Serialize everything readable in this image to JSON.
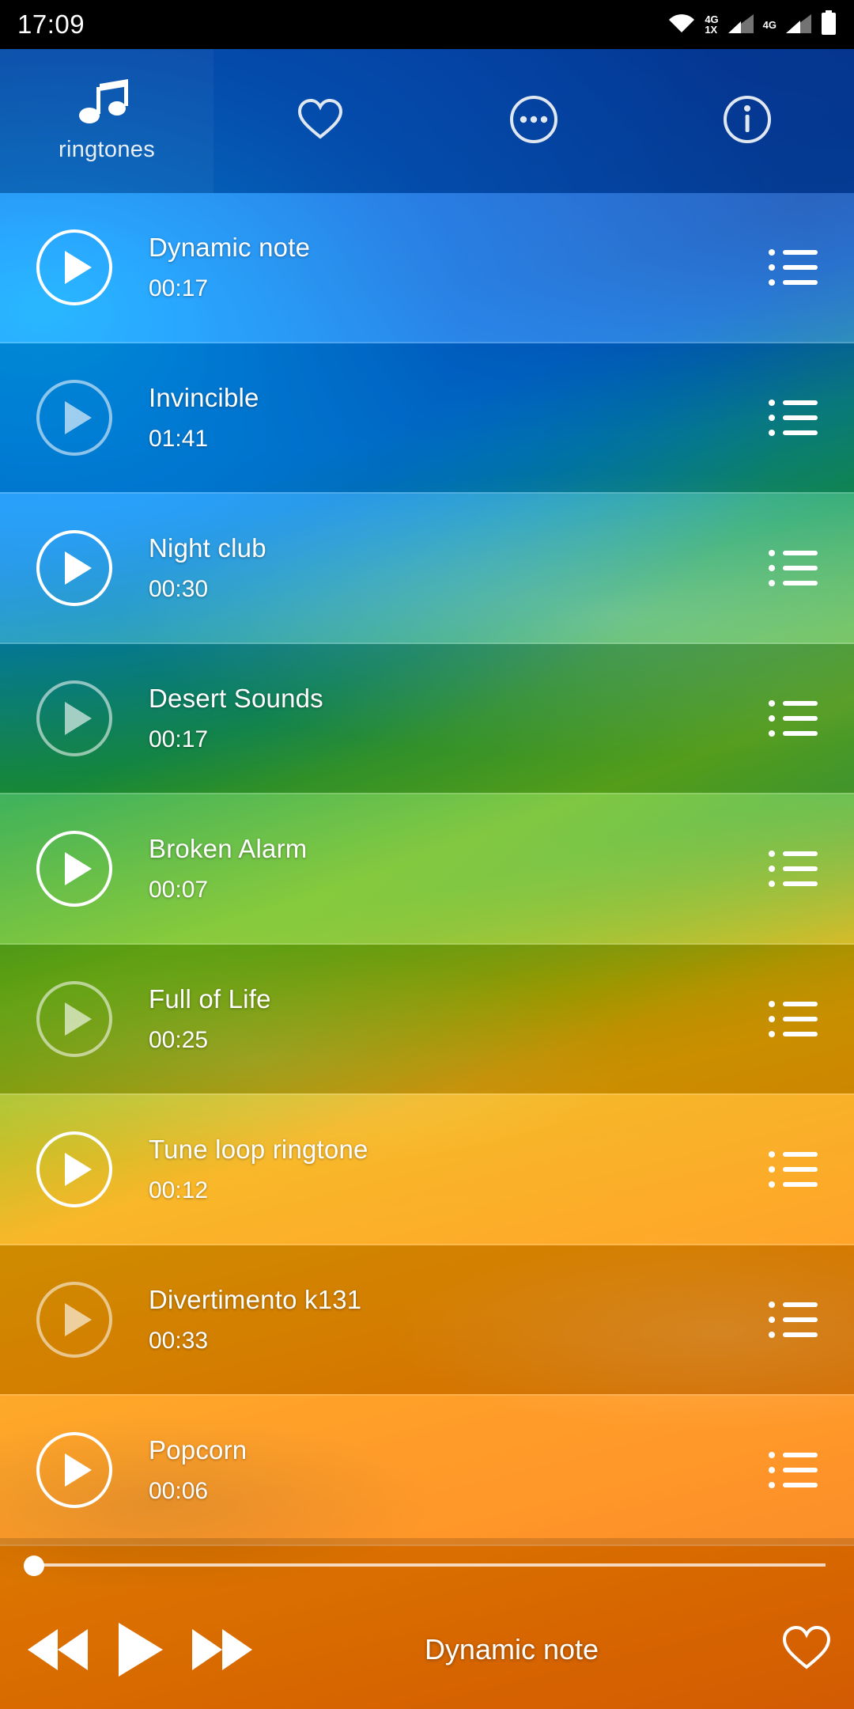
{
  "status_bar": {
    "clock": "17:09",
    "icons": [
      "wifi-icon",
      "signal-4g-1x-icon",
      "signal-4g-icon",
      "battery-icon"
    ],
    "net1_line1": "4G",
    "net1_line2": "1X",
    "net2_line1": "4G",
    "net2_line2": ""
  },
  "app_bar": {
    "tab_label": "ringtones",
    "tab_icon": "music-note-icon",
    "actions": [
      {
        "name": "favorites-icon",
        "glyph": "heart"
      },
      {
        "name": "more-options-icon",
        "glyph": "ellipsis-circle"
      },
      {
        "name": "info-icon",
        "glyph": "info-circle"
      }
    ]
  },
  "list": {
    "items": [
      {
        "title": "Dynamic note",
        "duration": "00:17",
        "selected": true,
        "play_state": "bright"
      },
      {
        "title": "Invincible",
        "duration": "01:41",
        "selected": false,
        "play_state": "dim"
      },
      {
        "title": "Night club",
        "duration": "00:30",
        "selected": true,
        "play_state": "bright"
      },
      {
        "title": "Desert Sounds",
        "duration": "00:17",
        "selected": false,
        "play_state": "dim"
      },
      {
        "title": "Broken Alarm",
        "duration": "00:07",
        "selected": true,
        "play_state": "bright"
      },
      {
        "title": "Full of Life",
        "duration": "00:25",
        "selected": false,
        "play_state": "dim"
      },
      {
        "title": "Tune loop ringtone",
        "duration": "00:12",
        "selected": true,
        "play_state": "bright"
      },
      {
        "title": "Divertimento k131",
        "duration": "00:33",
        "selected": false,
        "play_state": "dim"
      },
      {
        "title": "Popcorn",
        "duration": "00:06",
        "selected": true,
        "play_state": "bright"
      }
    ]
  },
  "player": {
    "now_playing": "Dynamic note",
    "progress_percent": 0,
    "prev_label": "rewind-icon",
    "play_label": "play-icon",
    "next_label": "fast-forward-icon",
    "favorite_label": "heart-outline-icon"
  },
  "colors": {
    "accent_white": "#ffffff",
    "appbar_overlay": "#0a285c",
    "status_bg": "#000000"
  }
}
